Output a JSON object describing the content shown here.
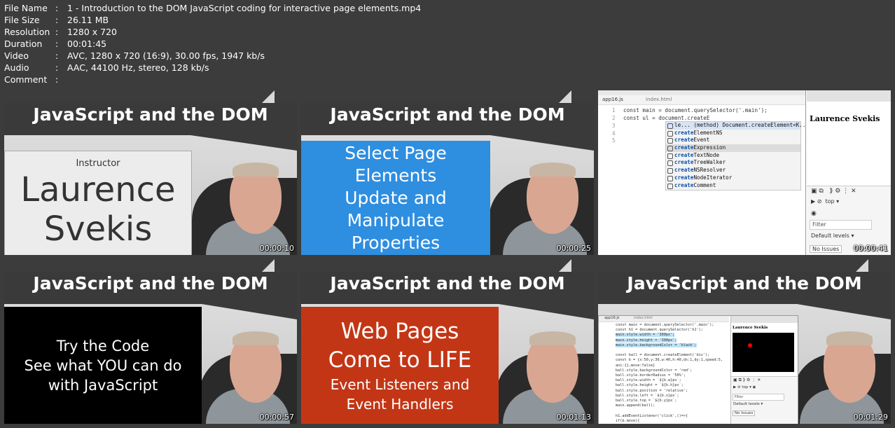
{
  "meta": [
    {
      "key": "File Name",
      "value": "1 - Introduction to the DOM JavaScript coding for interactive page elements.mp4"
    },
    {
      "key": "File Size",
      "value": "26.11 MB"
    },
    {
      "key": "Resolution",
      "value": "1280 x 720"
    },
    {
      "key": "Duration",
      "value": "00:01:45"
    },
    {
      "key": "Video",
      "value": "AVC, 1280 x 720 (16:9), 30.00 fps, 1947 kb/s"
    },
    {
      "key": "Audio",
      "value": "AAC, 44100 Hz, stereo, 128 kb/s"
    },
    {
      "key": "Comment",
      "value": ""
    }
  ],
  "separator": ":",
  "thumbs": [
    {
      "title": "JavaScript and the DOM",
      "timestamp": "00:00:10",
      "card": {
        "lines": [
          "Instructor",
          "Laurence",
          "Svekis"
        ]
      }
    },
    {
      "title": "JavaScript and the DOM",
      "timestamp": "00:00:25",
      "card": {
        "lines": [
          "Select Page",
          "Elements",
          "Update and",
          "Manipulate",
          "Properties"
        ]
      }
    },
    {
      "timestamp": "00:00:41",
      "editor": {
        "tab1": "app16.js",
        "tab2": "index.html",
        "line_numbers": [
          "1",
          "2",
          "3",
          "4",
          "5"
        ],
        "lines": [
          "const main = document.querySelector('.main');",
          "const ul = document.createE"
        ],
        "ac_header": "le...   (method) Document.createElement<K...",
        "ac_items": [
          {
            "prefix": "create",
            "rest": "ElementNS"
          },
          {
            "prefix": "create",
            "rest": "Event"
          },
          {
            "prefix": "create",
            "rest": "Expression"
          },
          {
            "prefix": "create",
            "rest": "TextNode"
          },
          {
            "prefix": "create",
            "rest": "TreeWalker"
          },
          {
            "prefix": "create",
            "rest": "NSResolver"
          },
          {
            "prefix": "create",
            "rest": "NodeIterator"
          },
          {
            "prefix": "create",
            "rest": "Comment"
          }
        ],
        "browser_heading": "Laurence Svekis",
        "devtools": {
          "context": "top",
          "filter": "Filter",
          "levels": "Default levels",
          "issues": "No Issues"
        }
      }
    },
    {
      "title": "JavaScript and the DOM",
      "timestamp": "00:00:57",
      "card": {
        "lines": [
          "Try the Code",
          "See what YOU can do",
          "with JavaScript"
        ]
      }
    },
    {
      "title": "JavaScript and the DOM",
      "timestamp": "00:01:13",
      "card": {
        "lines": [
          "Web Pages",
          "Come to LIFE",
          "Event Listeners and",
          "Event Handlers"
        ]
      }
    },
    {
      "title": "JavaScript and the DOM",
      "timestamp": "00:01:29",
      "editor": {
        "tab1": "app16.js",
        "tab2": "index.html",
        "lines": [
          "const main = document.querySelector('.main');",
          "const h1 = document.querySelector('h1');",
          "main.style.width = '300px';",
          "main.style.height = '300px';",
          "main.style.backgroundColor = 'black';",
          "",
          "const ball = document.createElement('div');",
          "const b = {x:50,y:30,w:40,h:40,dx:1,dy:1,speed:5,",
          "ani:{},move:false}",
          "ball.style.backgroundColor = 'red';",
          "ball.style.borderRadius = '50%';",
          "ball.style.width = `${b.w}px`;",
          "ball.style.height = `${b.h}px`;",
          "ball.style.position = 'relative';",
          "ball.style.left = `${b.x}px`;",
          "ball.style.top = `${b.y}px`;",
          "main.append(ball);",
          "",
          "h1.addEventListener('click',()=>{",
          "  if(b.move){"
        ],
        "browser_heading": "Laurence Svekis",
        "devtools": {
          "context": "top",
          "filter": "Filter",
          "levels": "Default levels",
          "issues": "No Issues"
        }
      }
    }
  ],
  "colors": {
    "band": "#3a3a3a",
    "blue_card": "#2e8ee0",
    "red_card": "#c23616",
    "black_card": "#000000",
    "white_card": "#ececec"
  }
}
